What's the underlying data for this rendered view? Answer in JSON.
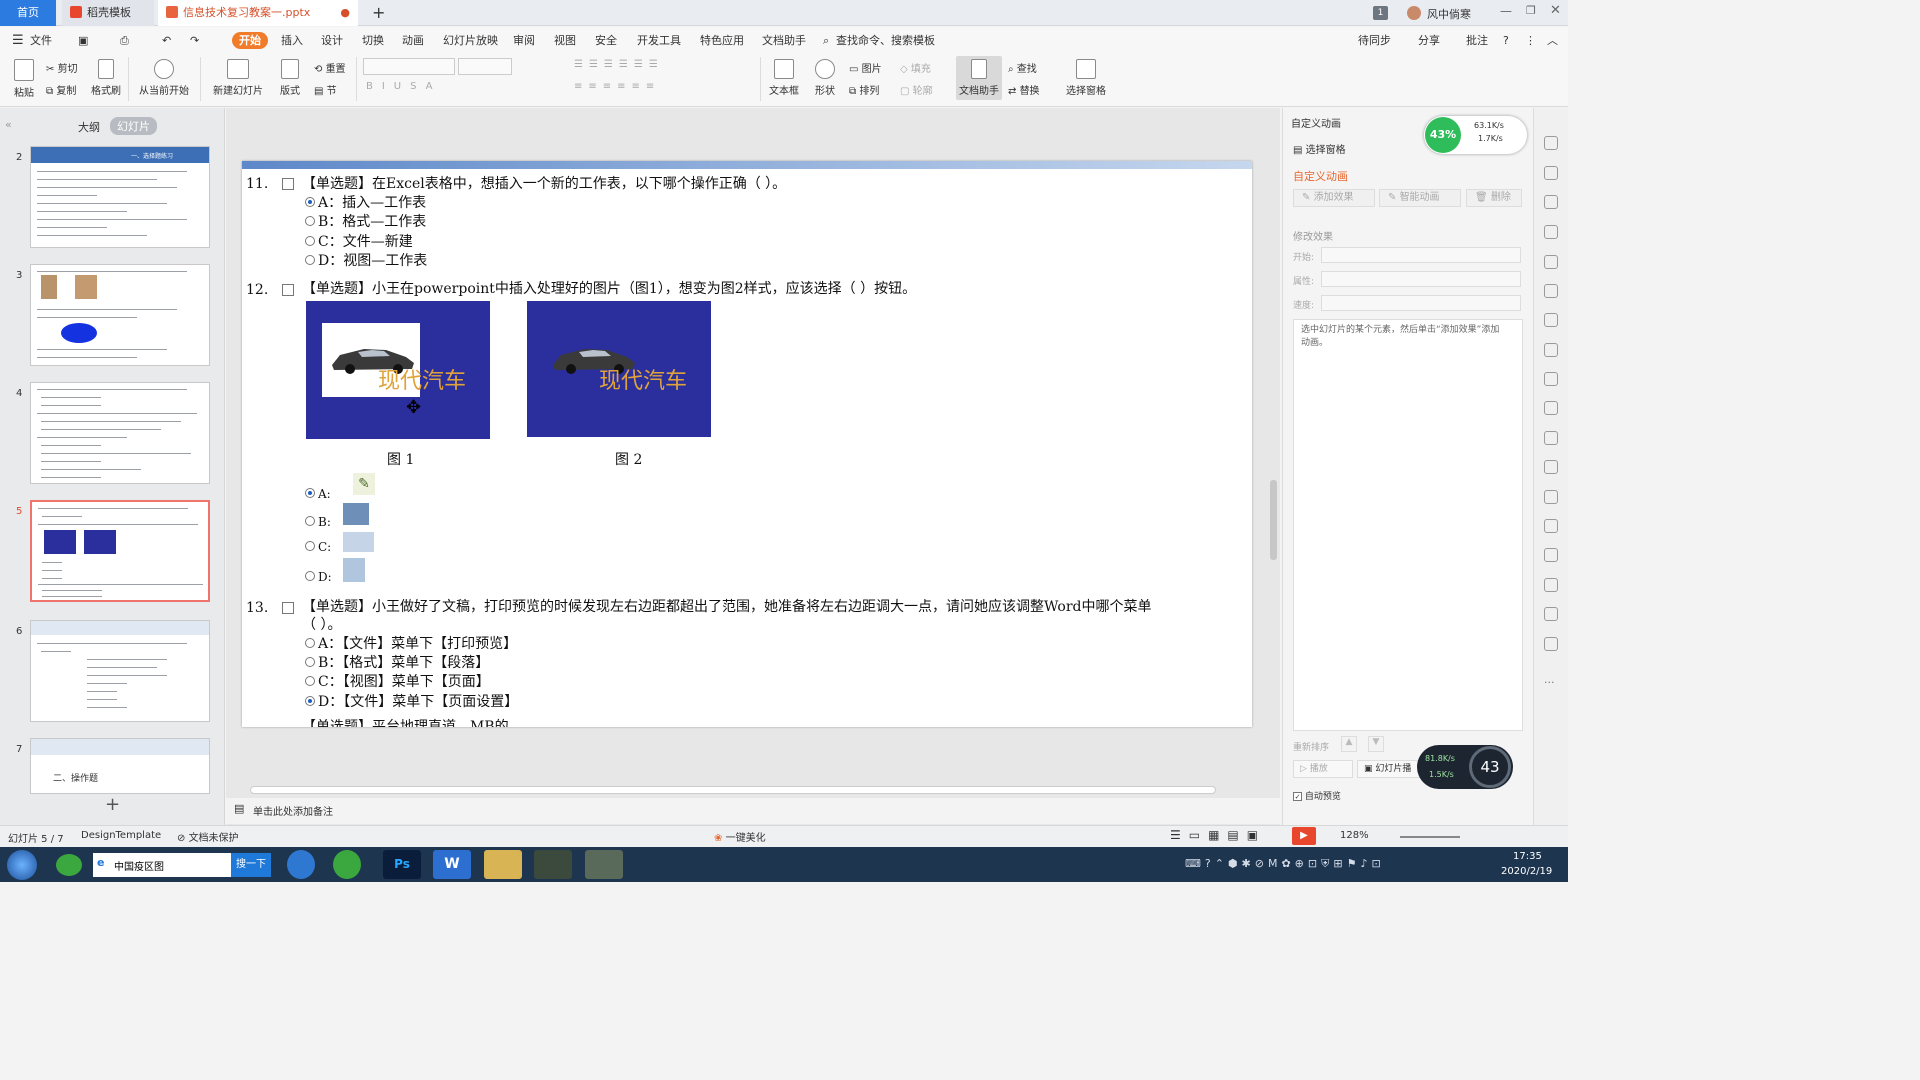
{
  "tabs": {
    "home": "首页",
    "template": "稻壳模板",
    "document": "信息技术复习教案一.pptx",
    "badge": "1",
    "user": "风中倘寒"
  },
  "menu": {
    "file": "文件",
    "items": [
      "开始",
      "插入",
      "设计",
      "切换",
      "动画",
      "幻灯片放映",
      "审阅",
      "视图",
      "安全",
      "开发工具",
      "特色应用",
      "文档助手"
    ],
    "search": "查找命令、搜索模板",
    "sync": "待同步",
    "share": "分享",
    "comment": "批注"
  },
  "ribbon": {
    "paste": "粘贴",
    "cut": "剪切",
    "copy": "复制",
    "format_painter": "格式刷",
    "from_current": "从当前开始",
    "new_slide": "新建幻灯片",
    "layout": "版式",
    "reset": "重置",
    "section": "节",
    "textbox": "文本框",
    "shape": "形状",
    "picture": "图片",
    "fill": "填充",
    "arrange": "排列",
    "outline": "轮廓",
    "doc_helper": "文档助手",
    "find": "查找",
    "replace": "替换",
    "select_pane": "选择窗格"
  },
  "leftpanel": {
    "outline_tab": "大纲",
    "slides_tab": "幻灯片",
    "thumbs": [
      "2",
      "3",
      "4",
      "5",
      "6",
      "7"
    ],
    "thumb7_text": "二、操作题",
    "thumb2_title": "一、选择题练习"
  },
  "slide": {
    "q11": {
      "num": "11.",
      "text": "【单选题】在Excel表格中，想插入一个新的工作表，以下哪个操作正确（    ）。",
      "options": [
        "A：插入—工作表",
        "B：格式—工作表",
        "C：文件—新建",
        "D：视图—工作表"
      ]
    },
    "q12": {
      "num": "12.",
      "text": "【单选题】小王在powerpoint中插入处理好的图片（图1），想变为图2样式，应该选择（    ）按钮。",
      "fig1": "图 1",
      "fig2": "图 2",
      "car_text": "现代汽车",
      "options": [
        "A:",
        "B:",
        "C:",
        "D:"
      ]
    },
    "q13": {
      "num": "13.",
      "text": "【单选题】小王做好了文稿，打印预览的时候发现左右边距都超出了范围，她准备将左右边距调大一点，请问她应该调整Word中哪个菜单",
      "text2": "（    ）。",
      "options": [
        "A：【文件】菜单下【打印预览】",
        "B：【格式】菜单下【段落】",
        "C：【视图】菜单下【页面】",
        "D：【文件】菜单下【页面设置】"
      ]
    },
    "q14_partial": "【单选题】平台地理直道…MB的…"
  },
  "rightpanel": {
    "title": "自定义动画",
    "select_pane": "选择窗格",
    "section_title": "自定义动画",
    "add_effect": "添加效果",
    "smart_anim": "智能动画",
    "delete": "删除",
    "modify": "修改效果",
    "start": "开始:",
    "property": "属性:",
    "speed": "速度:",
    "hint": "选中幻灯片的某个元素，然后单击“添加效果”添加动画。",
    "reorder": "重新排序",
    "play": "播放",
    "slideshow": "幻灯片播",
    "auto_preview": "自动预览"
  },
  "net": {
    "pct": "43%",
    "up": "63.1K/s",
    "down": "1.7K/s",
    "up2": "81.8K/s",
    "down2": "1.5K/s",
    "pct2": "43"
  },
  "notes": "单击此处添加备注",
  "status": {
    "slide": "幻灯片 5 / 7",
    "template": "DesignTemplate",
    "protect": "文档未保护",
    "beautify": "一键美化",
    "zoom": "128%"
  },
  "taskbar": {
    "search_text": "中国疫区图",
    "search_btn": "搜一下",
    "time": "17:35",
    "date": "2020/2/19"
  }
}
